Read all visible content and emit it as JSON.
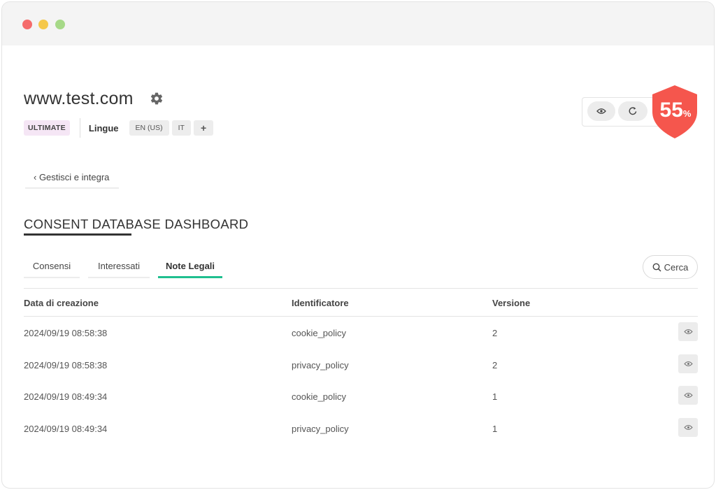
{
  "site": {
    "title": "www.test.com"
  },
  "plan": {
    "badge": "ULTIMATE"
  },
  "languages": {
    "label": "Lingue",
    "items": [
      "EN (US)",
      "IT"
    ],
    "add": "+"
  },
  "score": {
    "value": "55",
    "unit": "%",
    "color": "#f5564d"
  },
  "nav": {
    "back": "‹ Gestisci e integra"
  },
  "section": {
    "title": "CONSENT DATABASE DASHBOARD"
  },
  "tabs": [
    {
      "label": "Consensi",
      "active": false
    },
    {
      "label": "Interessati",
      "active": false
    },
    {
      "label": "Note Legali",
      "active": true
    }
  ],
  "search": {
    "label": "Cerca"
  },
  "accent": "#1fbf8f",
  "table": {
    "headers": [
      "Data di creazione",
      "Identificatore",
      "Versione"
    ],
    "rows": [
      [
        "2024/09/19 08:58:38",
        "cookie_policy",
        "2"
      ],
      [
        "2024/09/19 08:58:38",
        "privacy_policy",
        "2"
      ],
      [
        "2024/09/19 08:49:34",
        "cookie_policy",
        "1"
      ],
      [
        "2024/09/19 08:49:34",
        "privacy_policy",
        "1"
      ]
    ]
  }
}
